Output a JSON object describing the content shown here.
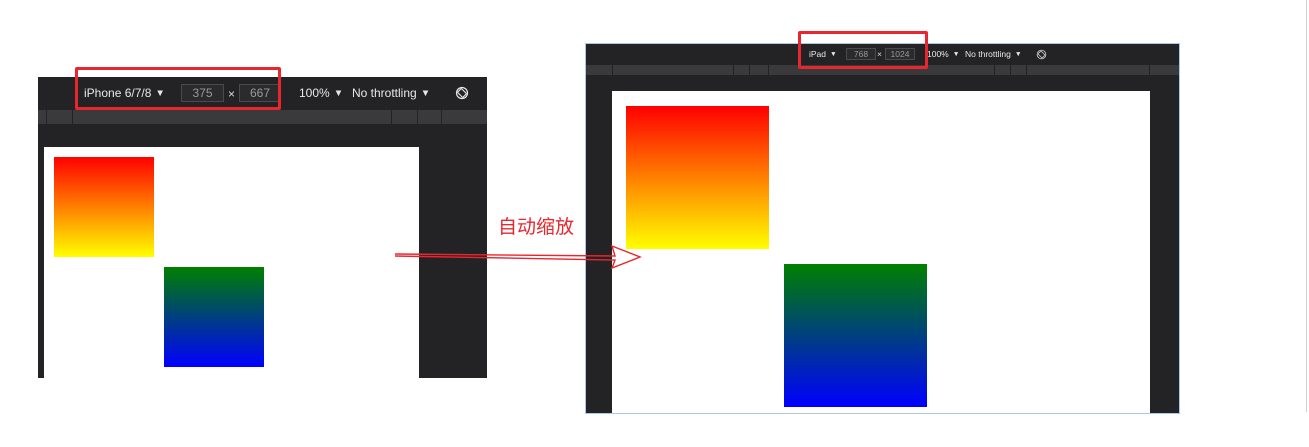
{
  "left_panel": {
    "device_label": "iPhone 6/7/8",
    "width_value": "375",
    "height_value": "667",
    "times_symbol": "×",
    "zoom_label": "100%",
    "throttling_label": "No throttling",
    "rotate_icon": "rotate-icon"
  },
  "right_panel": {
    "device_label": "iPad",
    "width_value": "768",
    "height_value": "1024",
    "times_symbol": "×",
    "zoom_label": "100%",
    "throttling_label": "No throttling",
    "rotate_icon": "rotate-icon"
  },
  "annotation": {
    "label": "自动缩放",
    "color": "#e8262e"
  },
  "colors": {
    "toolbar_bg": "#232325",
    "gradient_warm": [
      "#ff0000",
      "#ffff00"
    ],
    "gradient_cool": [
      "#008000",
      "#0000ff"
    ]
  }
}
